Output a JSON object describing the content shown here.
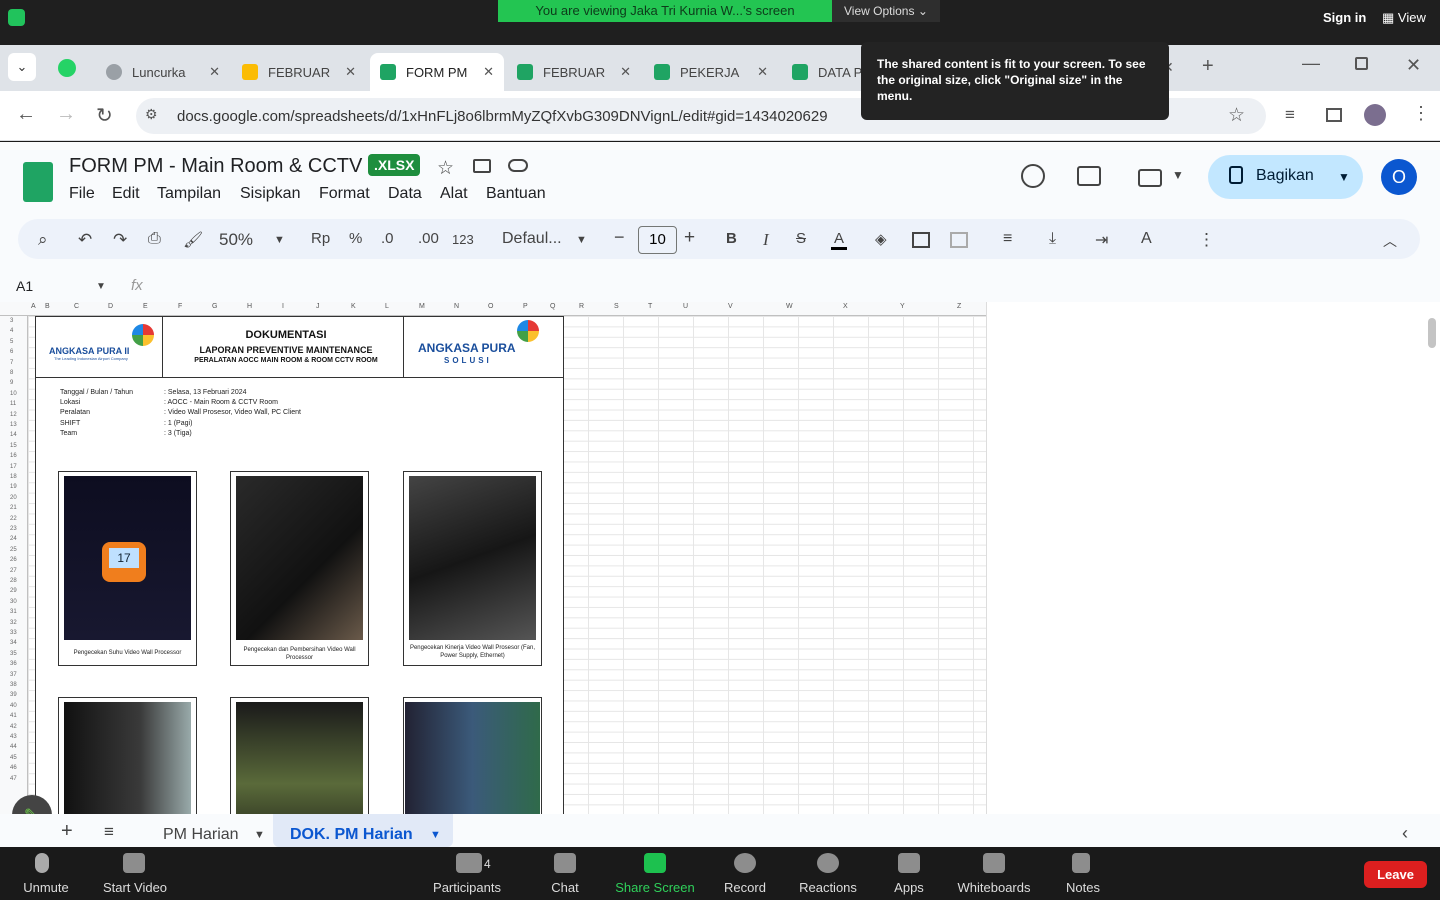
{
  "zoom_top": {
    "viewing": "You are viewing Jaka Tri Kurnia W...'s screen",
    "view_options": "View Options",
    "sign_in": "Sign in",
    "view": "View"
  },
  "tabs": [
    {
      "label": "Luncurka",
      "color": "#9aa0a6"
    },
    {
      "label": "FEBRUAR",
      "color": "#fbbc04"
    },
    {
      "label": "FORM PM",
      "color": "#1fa463"
    },
    {
      "label": "FEBRUAR",
      "color": "#1fa463"
    },
    {
      "label": "PEKERJA",
      "color": "#1fa463"
    },
    {
      "label": "DATA P",
      "color": "#1fa463"
    }
  ],
  "address": {
    "url": "docs.google.com/spreadsheets/d/1xHnFLj8o6lbrmMyZQfXvbG309DNVignL/edit#gid=1434020629"
  },
  "tooltip": "The shared content is fit to your screen. To see the original size, click \"Original size\" in the menu.",
  "doc": {
    "title": "FORM PM - Main Room & CCTV",
    "badge": ".XLSX",
    "menus": [
      "File",
      "Edit",
      "Tampilan",
      "Sisipkan",
      "Format",
      "Data",
      "Alat",
      "Bantuan"
    ],
    "share": "Bagikan",
    "avatar": "O"
  },
  "toolbar": {
    "zoom": "50%",
    "currency": "Rp",
    "percent": "%",
    "dec_less": ".0",
    "dec_more": ".00",
    "format": "123",
    "font": "Defaul...",
    "font_size": "10"
  },
  "namebox": "A1",
  "fx": "fx",
  "columns": [
    "A",
    "B",
    "C",
    "D",
    "E",
    "F",
    "G",
    "H",
    "I",
    "J",
    "K",
    "L",
    "M",
    "N",
    "O",
    "P",
    "Q",
    "R",
    "S",
    "T",
    "U",
    "V",
    "W",
    "X",
    "Y",
    "Z"
  ],
  "rows": [
    "3",
    "4",
    "5",
    "6",
    "7",
    "8",
    "9",
    "10",
    "11",
    "12",
    "13",
    "14",
    "15",
    "16",
    "17",
    "18",
    "19",
    "20",
    "21",
    "22",
    "23",
    "24",
    "25",
    "26",
    "27",
    "28",
    "29",
    "30",
    "31",
    "32",
    "33",
    "34",
    "35",
    "36",
    "37",
    "38",
    "39",
    "40",
    "41",
    "42",
    "43",
    "44",
    "45",
    "46",
    "47"
  ],
  "sheet": {
    "ap2": "ANGKASA PURA II",
    "ap2_sub": "The Leading Indonesian Airport Company",
    "heading1": "DOKUMENTASI",
    "heading2": "LAPORAN PREVENTIVE MAINTENANCE",
    "heading3": "PERALATAN AOCC MAIN ROOM & ROOM CCTV ROOM",
    "aps1": "ANGKASA PURA",
    "aps2": "SOLUSI",
    "info": [
      {
        "label": "Tanggal / Bulan / Tahun",
        "value": ": Selasa, 13 Februari 2024"
      },
      {
        "label": "Lokasi",
        "value": ": AOCC - Main Room & CCTV Room"
      },
      {
        "label": "Peralatan",
        "value": ": Video Wall Prosesor, Video Wall, PC Client"
      },
      {
        "label": "SHIFT",
        "value": ": 1 (Pagi)"
      },
      {
        "label": "Team",
        "value": ": 3 (Tiga)"
      }
    ],
    "captions": [
      "Pengecekan Suhu Video Wall Processor",
      "Pengecekan dan Pembersihan Video Wall Processor",
      "Pengecekan Kinerja Video Wall Prosesor (Fan, Power Supply, Ethernet)"
    ],
    "temp_reading": "17"
  },
  "sheet_tabs": [
    "PM Harian",
    "DOK. PM Harian"
  ],
  "zoom_bottom": {
    "unmute": "Unmute",
    "start_video": "Start Video",
    "participants": "Participants",
    "participants_count": "4",
    "chat": "Chat",
    "share_screen": "Share Screen",
    "record": "Record",
    "reactions": "Reactions",
    "apps": "Apps",
    "whiteboards": "Whiteboards",
    "notes": "Notes",
    "leave": "Leave"
  }
}
